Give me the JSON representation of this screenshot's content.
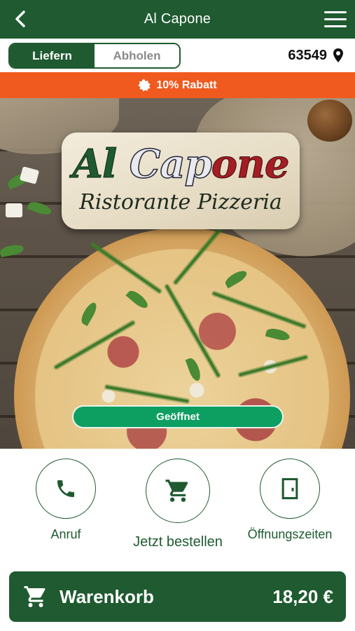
{
  "header": {
    "title": "Al Capone",
    "back_icon": "chevron-left-icon",
    "menu_icon": "hamburger-menu-icon"
  },
  "order_mode": {
    "options": [
      "Liefern",
      "Abholen"
    ],
    "selected": "Liefern"
  },
  "location": {
    "zip": "63549",
    "icon": "location-pin-icon"
  },
  "promo": {
    "text": "10% Rabatt",
    "icon": "badge-icon",
    "color": "#f05a1e"
  },
  "hero": {
    "logo": {
      "line1_part1": "Al",
      "line1_part2": "Cap",
      "line1_part3": "one",
      "line2": "Ristorante Pizzeria"
    },
    "status": "Geöffnet"
  },
  "actions": [
    {
      "label": "Anruf",
      "icon": "phone-icon"
    },
    {
      "label": "Jetzt bestellen",
      "icon": "cart-icon"
    },
    {
      "label": "Öffnungszeiten",
      "icon": "door-icon"
    }
  ],
  "cart": {
    "label": "Warenkorb",
    "total": "18,20 €",
    "icon": "cart-icon"
  },
  "colors": {
    "brand_green": "#1f5a30",
    "status_green": "#0d9e62",
    "promo_orange": "#f05a1e"
  }
}
